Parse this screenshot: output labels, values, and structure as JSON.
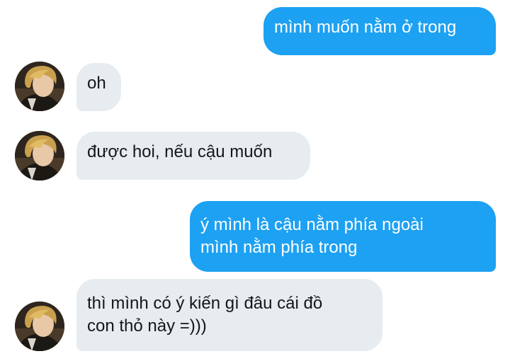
{
  "conversation": {
    "messages": [
      {
        "sender": "me",
        "text": "mình muốn nằm ở trong"
      },
      {
        "sender": "other",
        "text": "oh"
      },
      {
        "sender": "other",
        "text": "được hoi, nếu cậu muốn"
      },
      {
        "sender": "me",
        "text": "ý mình là cậu nằm phía ngoài\nmình nằm phía trong"
      },
      {
        "sender": "other",
        "text": "thì mình có ý kiến gì đâu cái đồ\ncon thỏ này =)))"
      }
    ],
    "contact_avatar": "contact-avatar-photo"
  },
  "colors": {
    "sent_bubble": "#1da1f2",
    "received_bubble": "#e6ecf0",
    "sent_text": "#ffffff",
    "received_text": "#14171a"
  }
}
